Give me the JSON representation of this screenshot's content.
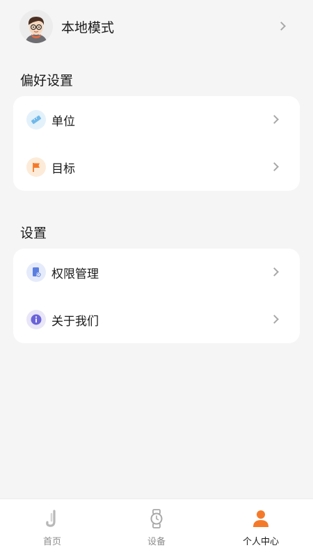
{
  "profile": {
    "name": "本地模式"
  },
  "preferences": {
    "title": "偏好设置",
    "items": [
      {
        "label": "单位",
        "icon": "ruler-icon"
      },
      {
        "label": "目标",
        "icon": "flag-icon"
      }
    ]
  },
  "settings": {
    "title": "设置",
    "items": [
      {
        "label": "权限管理",
        "icon": "permission-icon"
      },
      {
        "label": "关于我们",
        "icon": "info-icon"
      }
    ]
  },
  "tabbar": {
    "items": [
      {
        "label": "首页",
        "icon": "home-icon"
      },
      {
        "label": "设备",
        "icon": "watch-icon"
      },
      {
        "label": "个人中心",
        "icon": "person-icon",
        "active": true
      }
    ]
  },
  "colors": {
    "accent": "#f47a2a",
    "background": "#f5f5f5"
  }
}
